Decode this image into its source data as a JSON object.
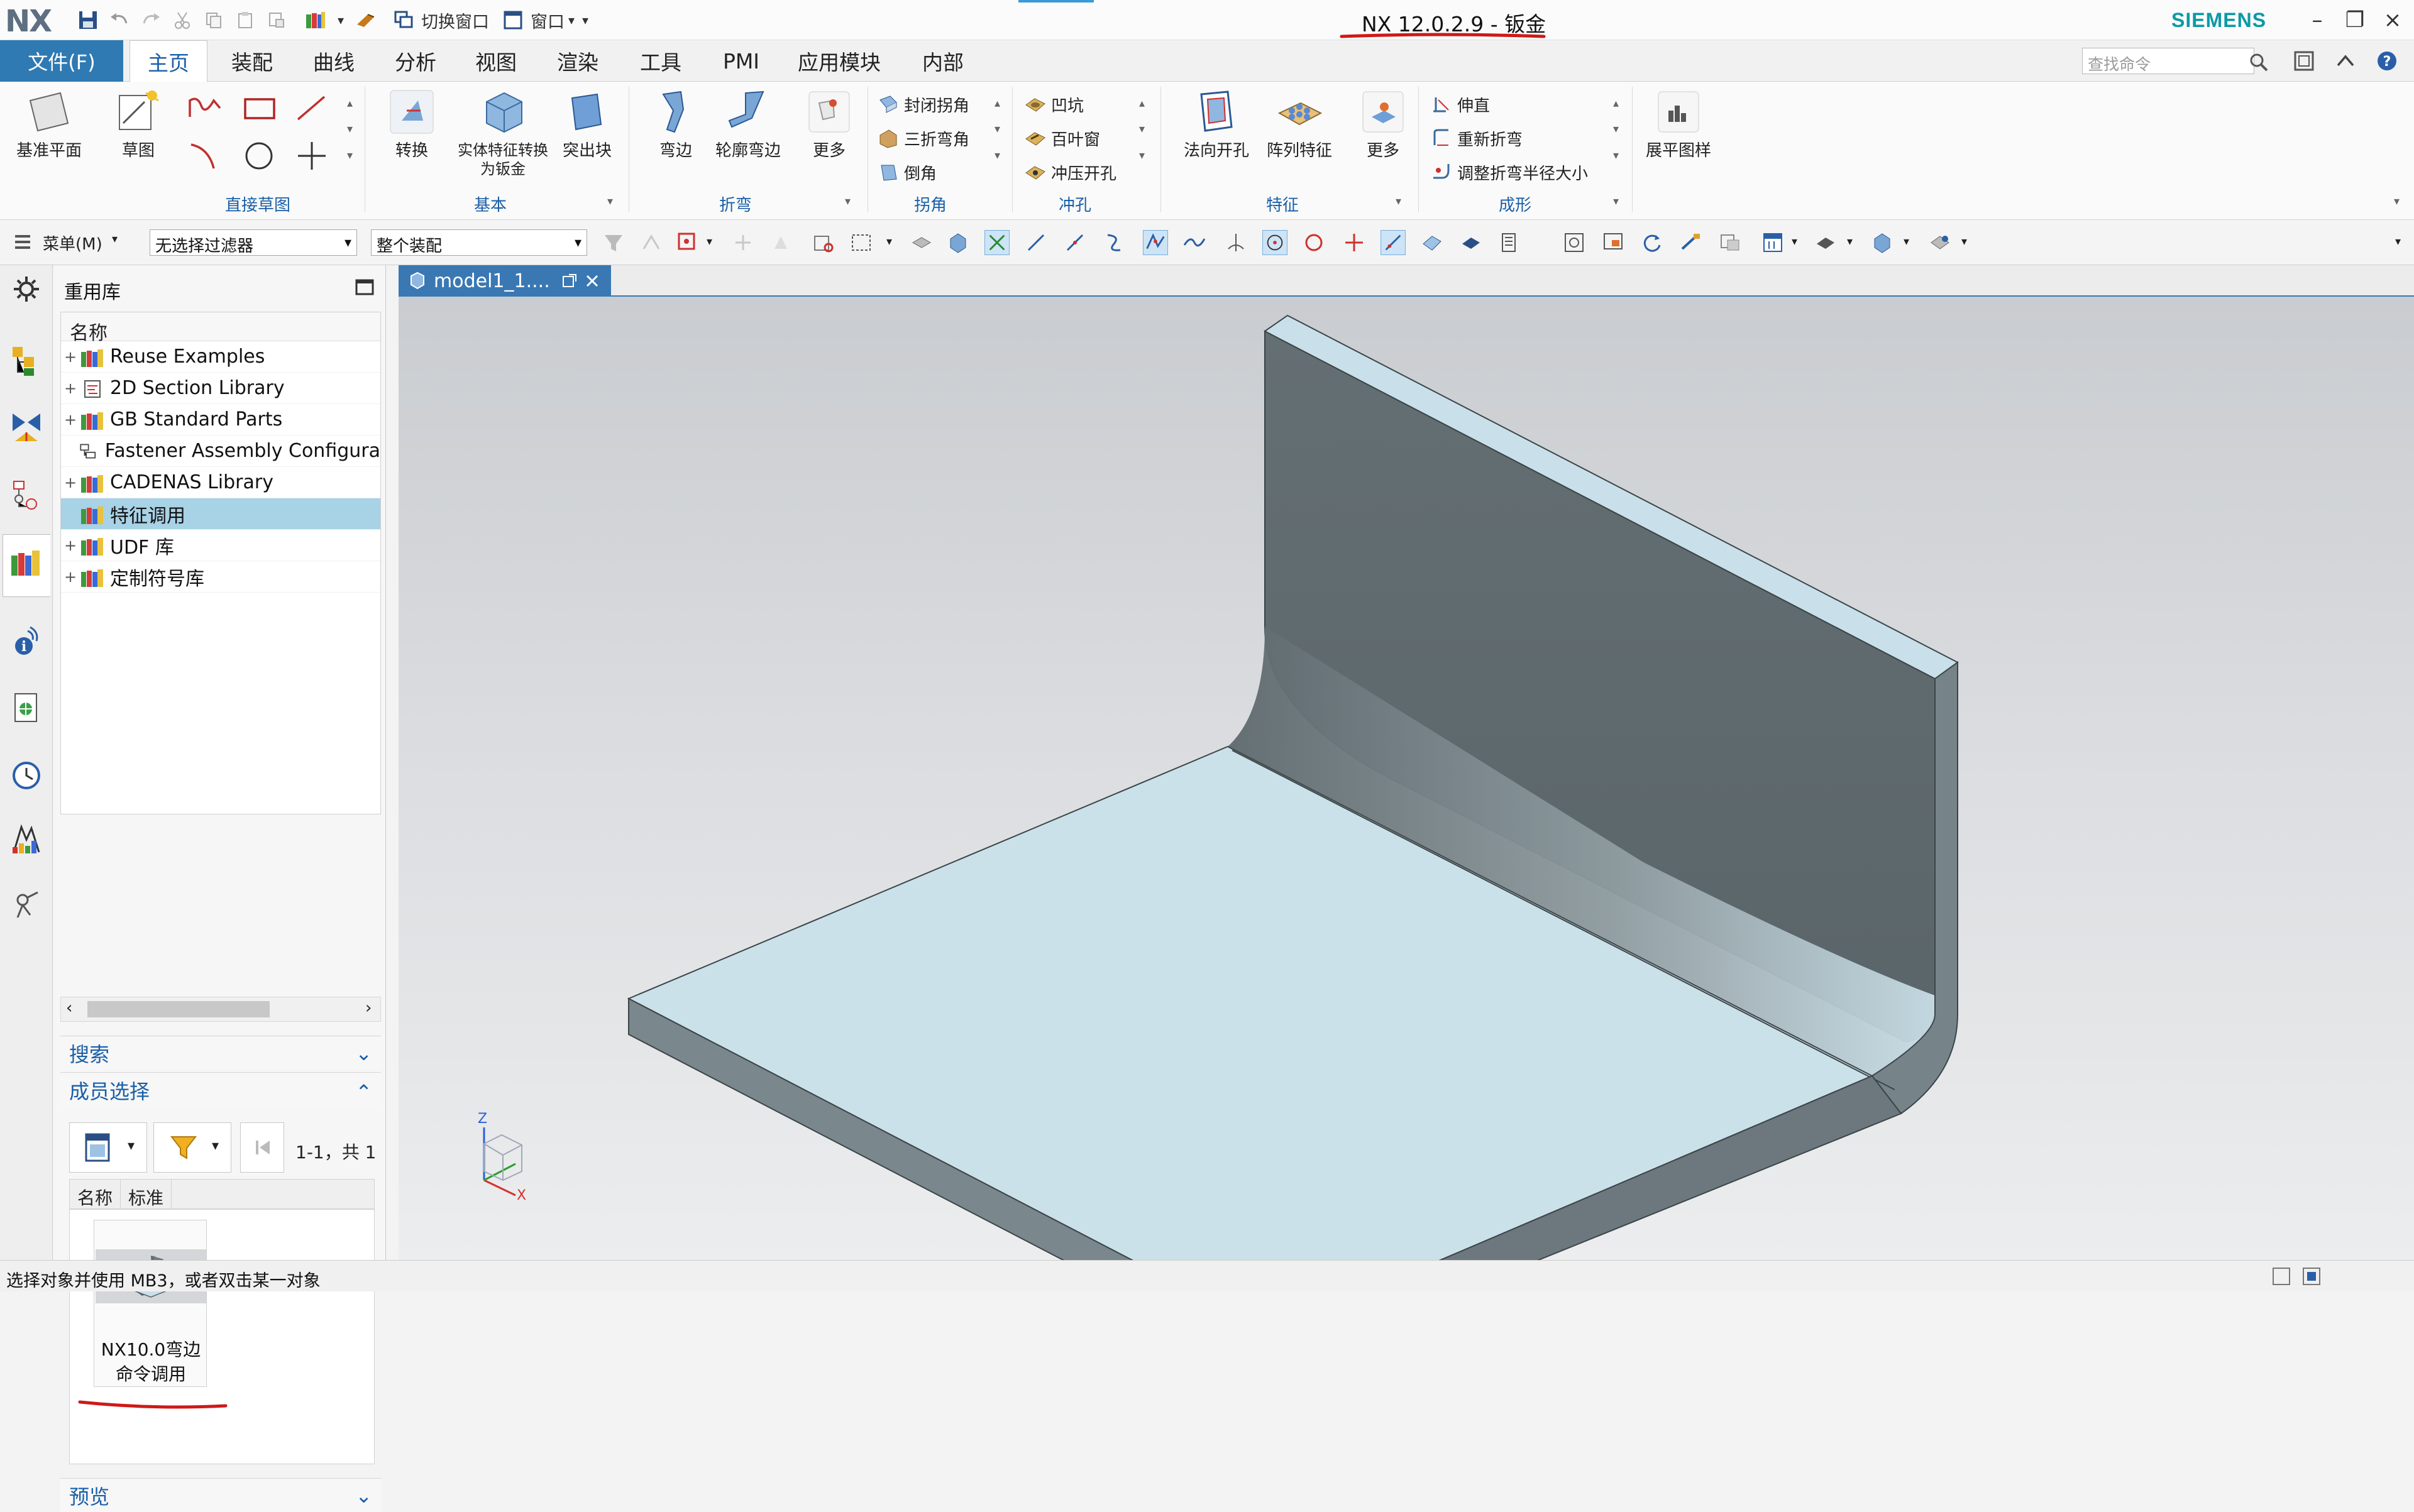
{
  "app": {
    "logo": "NX",
    "title": "NX 12.0.2.9 - 钣金",
    "brand": "SIEMENS",
    "quick_access": {
      "switch_window_label": "切换窗口",
      "window_label": "窗口"
    },
    "window_controls": [
      "–",
      "❐",
      "×"
    ]
  },
  "menu_tabs": [
    "文件(F)",
    "主页",
    "装配",
    "曲线",
    "分析",
    "视图",
    "渲染",
    "工具",
    "PMI",
    "应用模块",
    "内部"
  ],
  "active_tab": "主页",
  "search": {
    "placeholder": "查找命令"
  },
  "ribbon": {
    "datum_plane": "基准平面",
    "sketch": "草图",
    "direct_sketch_group": "直接草图",
    "convert": "转换",
    "convert_solid": "实体特征转换为钣金",
    "tab_extrude": "突出块",
    "basic_group": "基本",
    "flange": "弯边",
    "contour_flange": "轮廓弯边",
    "more_bend": "更多",
    "bend_group": "折弯",
    "corner_items": [
      "封闭拐角",
      "三折弯角",
      "倒角"
    ],
    "corner_group": "拐角",
    "punch_items": [
      "凹坑",
      "百叶窗",
      "冲压开孔"
    ],
    "punch_group": "冲孔",
    "normal_cutout": "法向开孔",
    "pattern_feature": "阵列特征",
    "more_feature": "更多",
    "feature_group": "特征",
    "form_items": [
      "伸直",
      "重新折弯",
      "调整折弯半径大小"
    ],
    "form_group": "成形",
    "flat_pattern": "展平图样"
  },
  "toolbar": {
    "menu_label": "菜单(M)",
    "filter_value": "无选择过滤器",
    "scope_value": "整个装配"
  },
  "panel": {
    "title": "重用库",
    "column_name": "名称",
    "tree": [
      {
        "label": "Reuse Examples",
        "expandable": true
      },
      {
        "label": "2D Section Library",
        "expandable": true
      },
      {
        "label": "GB Standard Parts",
        "expandable": true
      },
      {
        "label": "Fastener Assembly Configura",
        "expandable": false
      },
      {
        "label": "CADENAS Library",
        "expandable": true
      },
      {
        "label": "特征调用",
        "expandable": false,
        "selected": true
      },
      {
        "label": "UDF 库",
        "expandable": true
      },
      {
        "label": "定制符号库",
        "expandable": true
      }
    ],
    "search_section": "搜索",
    "member_section": "成员选择",
    "member_count": "1-1，共 1",
    "member_columns": [
      "名称",
      "标准"
    ],
    "member_item": "NX10.0弯边命令调用",
    "preview_section": "预览"
  },
  "document_tab": {
    "label": "model1_1...."
  },
  "triad": {
    "z": "Z",
    "x": "X"
  },
  "status_text": "选择对象并使用 MB3，或者双击某一对象",
  "colors": {
    "accent": "#2f7ab3",
    "brand": "#0c9aa6",
    "selection": "#a8d2e6",
    "annotation": "#d01818",
    "part_top": "#c8e0ea",
    "part_side": "#6e7a7e"
  }
}
